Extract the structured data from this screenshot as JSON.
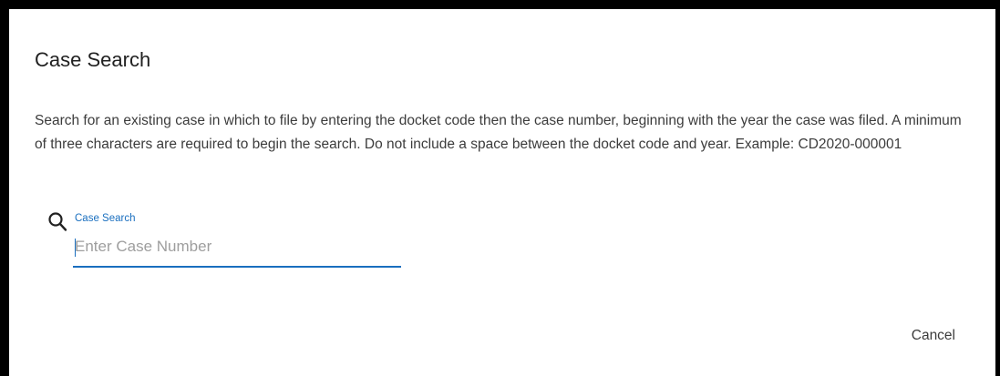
{
  "dialog": {
    "title": "Case Search",
    "description": "Search for an existing case in which to file by entering the docket code then the case number, beginning with the year the case was filed. A minimum of three characters are required to begin the search. Do not include a space between the docket code and year. Example: CD2020-000001"
  },
  "search": {
    "label": "Case Search",
    "placeholder": "Enter Case Number",
    "value": "",
    "icon": "search-icon"
  },
  "actions": {
    "cancel_label": "Cancel"
  },
  "colors": {
    "accent": "#1a6fbf",
    "frame": "#000000",
    "background": "#ffffff"
  }
}
